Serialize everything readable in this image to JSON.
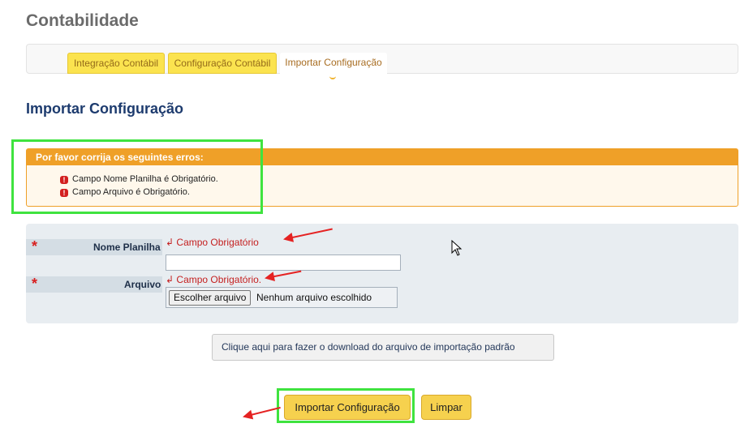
{
  "page": {
    "title": "Contabilidade"
  },
  "tabs": [
    {
      "label": "Integração Contábil"
    },
    {
      "label": "Configuração Contábil"
    },
    {
      "label": "Importar Configuração"
    }
  ],
  "section": {
    "title": "Importar Configuração"
  },
  "errors": {
    "heading": "Por favor corrija os seguintes erros:",
    "items": [
      "Campo Nome Planilha é Obrigatório.",
      "Campo Arquivo é Obrigatório."
    ],
    "icon": "!"
  },
  "form": {
    "required_mark": "*",
    "nome_planilha": {
      "label": "Nome Planilha",
      "error": "Campo Obrigatório",
      "value": ""
    },
    "arquivo": {
      "label": "Arquivo",
      "error": "Campo Obrigatório.",
      "button_label": "Escolher arquivo",
      "status": "Nenhum arquivo escolhido"
    },
    "error_arrow": "↲"
  },
  "download": {
    "label": "Clique aqui para fazer o download do arquivo de importação padrão"
  },
  "actions": {
    "import_label": "Importar Configuração",
    "clear_label": "Limpar"
  },
  "colors": {
    "accent": "#f6d14e",
    "error_header": "#efa028",
    "error_text": "#c41f1f",
    "highlight": "#3fe33f",
    "annotation_arrow": "#e52222"
  }
}
